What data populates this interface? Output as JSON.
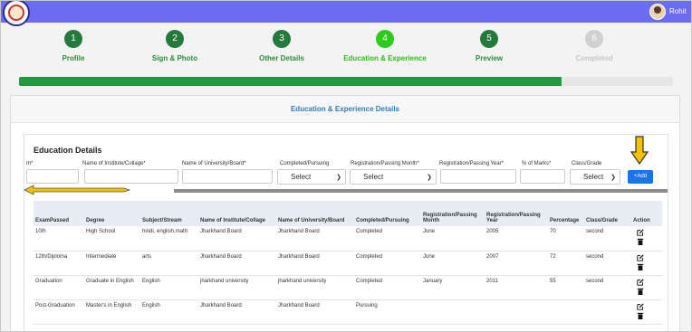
{
  "header": {
    "username": "Rohit"
  },
  "steps": [
    {
      "number": "1",
      "label": "Profile",
      "state": "done"
    },
    {
      "number": "2",
      "label": "Sign & Photo",
      "state": "done"
    },
    {
      "number": "3",
      "label": "Other Details",
      "state": "done"
    },
    {
      "number": "4",
      "label": "Education & Experience",
      "state": "active"
    },
    {
      "number": "5",
      "label": "Preview",
      "state": "done"
    },
    {
      "number": "6",
      "label": "Completed",
      "state": "pending"
    }
  ],
  "progress": 0.83,
  "card": {
    "title": "Education & Experience Details"
  },
  "form": {
    "section_title": "Education Details",
    "labels": {
      "exam": "m*",
      "institute": "Name of Institute/Collage*",
      "university": "Name of University/Board*",
      "status": "Completed/Pursuing",
      "month": "Registration/Passing Month*",
      "year": "Registration/Passing Year*",
      "marks": "% of Marks*",
      "grade": "Class/Grade"
    },
    "status_select": "Select",
    "month_select": "Select",
    "grade_select": "Select",
    "add_button": "+Add"
  },
  "table": {
    "headers": {
      "exam": "ExamPassed",
      "degree": "Degree",
      "subject": "Subject/Stream",
      "institute": "Name of Institute/Collage",
      "university": "Name of University/Board",
      "status": "Completed/Pursuing",
      "month": "Registration/Passing Month",
      "year": "Registration/Passing Year",
      "percentage": "Percentage",
      "grade": "Class/Grade",
      "action": "Action"
    },
    "rows": [
      {
        "exam": "10th",
        "degree": "High School",
        "subject": "hindi, english,math",
        "institute": "Jharkhand Board",
        "university": "Jharkhand Board",
        "status": "Completed",
        "month": "June",
        "year": "2005",
        "percentage": "70",
        "grade": "second"
      },
      {
        "exam": "12th/Diploma",
        "degree": "Intermediate",
        "subject": "arts",
        "institute": "Jharkhand Board",
        "university": "Jharkhand Board",
        "status": "Completed",
        "month": "June",
        "year": "2007",
        "percentage": "72",
        "grade": "second"
      },
      {
        "exam": "Graduation",
        "degree": "Graduate in English",
        "subject": "English",
        "institute": "jharkhand university",
        "university": "jharkhand university",
        "status": "Completed",
        "month": "January",
        "year": "2011",
        "percentage": "55",
        "grade": "second"
      },
      {
        "exam": "Post-Graduation",
        "degree": "Master's in English",
        "subject": "English",
        "institute": "Jharkhand Board",
        "university": "Jharkhand Board",
        "status": "Pursuing",
        "month": "",
        "year": "",
        "percentage": "",
        "grade": ""
      }
    ]
  },
  "colors": {
    "topbar": "#6c6cf0",
    "step_done": "#247a3a",
    "step_active": "#2ecc1a",
    "progress": "#259641",
    "accent": "#1a73e8",
    "annotation_arrow": "#f2c200"
  },
  "icons": [
    "logo-emblem",
    "user-avatar",
    "chevron-down-icon",
    "edit-icon",
    "trash-icon",
    "annotation-down-arrow",
    "annotation-right-arrow"
  ]
}
